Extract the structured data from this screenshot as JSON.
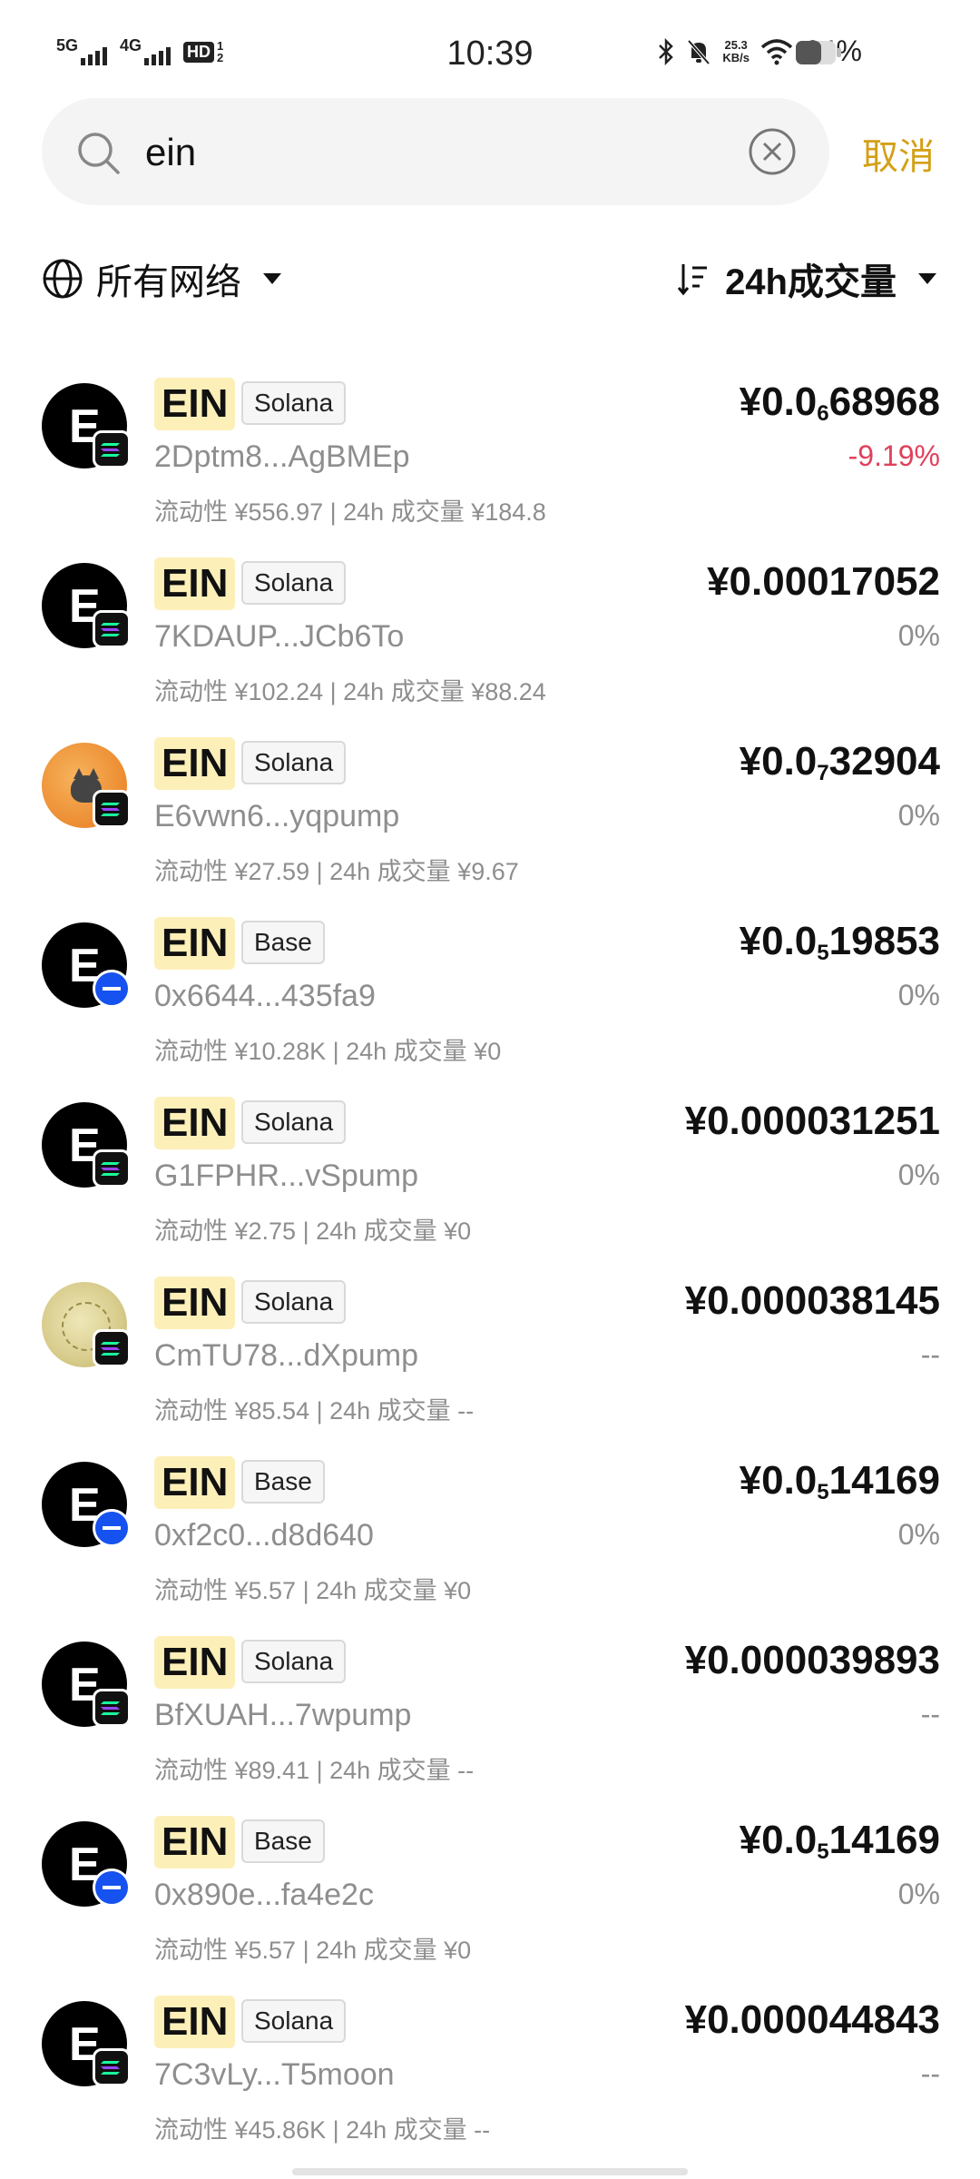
{
  "status_bar": {
    "sig1": "5G",
    "sig2": "4G",
    "hd": "HD",
    "hd_frac_top": "1",
    "hd_frac_bottom": "2",
    "time": "10:39",
    "net_speed_value": "25.3",
    "net_speed_unit": "KB/s",
    "battery_pct": "64%"
  },
  "search": {
    "value": "ein",
    "cancel_label": "取消"
  },
  "filters": {
    "network_label": "所有网络",
    "sort_label": "24h成交量"
  },
  "colors": {
    "accent": "#d4a017",
    "negative": "#e0415c",
    "symbol_bg": "#fdefb8",
    "base_blue": "#1652f0"
  },
  "tokens": [
    {
      "symbol": "EIN",
      "chain": "Solana",
      "address": "2Dptm8...AgBMEp",
      "liquidity": "流动性 ¥556.97",
      "volume": "24h 成交量 ¥184.8",
      "price_prefix": "¥0.0",
      "price_sub": "6",
      "price_rest": "68968",
      "change": "-9.19%",
      "change_neg": true,
      "avatar": "letter"
    },
    {
      "symbol": "EIN",
      "chain": "Solana",
      "address": "7KDAUP...JCb6To",
      "liquidity": "流动性 ¥102.24",
      "volume": "24h 成交量 ¥88.24",
      "price_prefix": "¥0.00017052",
      "price_sub": "",
      "price_rest": "",
      "change": "0%",
      "change_neg": false,
      "avatar": "letter"
    },
    {
      "symbol": "EIN",
      "chain": "Solana",
      "address": "E6vwn6...yqpump",
      "liquidity": "流动性 ¥27.59",
      "volume": "24h 成交量 ¥9.67",
      "price_prefix": "¥0.0",
      "price_sub": "7",
      "price_rest": "32904",
      "change": "0%",
      "change_neg": false,
      "avatar": "cat"
    },
    {
      "symbol": "EIN",
      "chain": "Base",
      "address": "0x6644...435fa9",
      "liquidity": "流动性 ¥10.28K",
      "volume": "24h 成交量 ¥0",
      "price_prefix": "¥0.0",
      "price_sub": "5",
      "price_rest": "19853",
      "change": "0%",
      "change_neg": false,
      "avatar": "letter"
    },
    {
      "symbol": "EIN",
      "chain": "Solana",
      "address": "G1FPHR...vSpump",
      "liquidity": "流动性 ¥2.75",
      "volume": "24h 成交量 ¥0",
      "price_prefix": "¥0.000031251",
      "price_sub": "",
      "price_rest": "",
      "change": "0%",
      "change_neg": false,
      "avatar": "letter"
    },
    {
      "symbol": "EIN",
      "chain": "Solana",
      "address": "CmTU78...dXpump",
      "liquidity": "流动性 ¥85.54",
      "volume": "24h 成交量 --",
      "price_prefix": "¥0.000038145",
      "price_sub": "",
      "price_rest": "",
      "change": "--",
      "change_neg": false,
      "avatar": "coin"
    },
    {
      "symbol": "EIN",
      "chain": "Base",
      "address": "0xf2c0...d8d640",
      "liquidity": "流动性 ¥5.57",
      "volume": "24h 成交量 ¥0",
      "price_prefix": "¥0.0",
      "price_sub": "5",
      "price_rest": "14169",
      "change": "0%",
      "change_neg": false,
      "avatar": "letter"
    },
    {
      "symbol": "EIN",
      "chain": "Solana",
      "address": "BfXUAH...7wpump",
      "liquidity": "流动性 ¥89.41",
      "volume": "24h 成交量 --",
      "price_prefix": "¥0.000039893",
      "price_sub": "",
      "price_rest": "",
      "change": "--",
      "change_neg": false,
      "avatar": "letter"
    },
    {
      "symbol": "EIN",
      "chain": "Base",
      "address": "0x890e...fa4e2c",
      "liquidity": "流动性 ¥5.57",
      "volume": "24h 成交量 ¥0",
      "price_prefix": "¥0.0",
      "price_sub": "5",
      "price_rest": "14169",
      "change": "0%",
      "change_neg": false,
      "avatar": "letter"
    },
    {
      "symbol": "EIN",
      "chain": "Solana",
      "address": "7C3vLy...T5moon",
      "liquidity": "流动性 ¥45.86K",
      "volume": "24h 成交量 --",
      "price_prefix": "¥0.000044843",
      "price_sub": "",
      "price_rest": "",
      "change": "--",
      "change_neg": false,
      "avatar": "letter"
    }
  ],
  "token_letter": "E"
}
